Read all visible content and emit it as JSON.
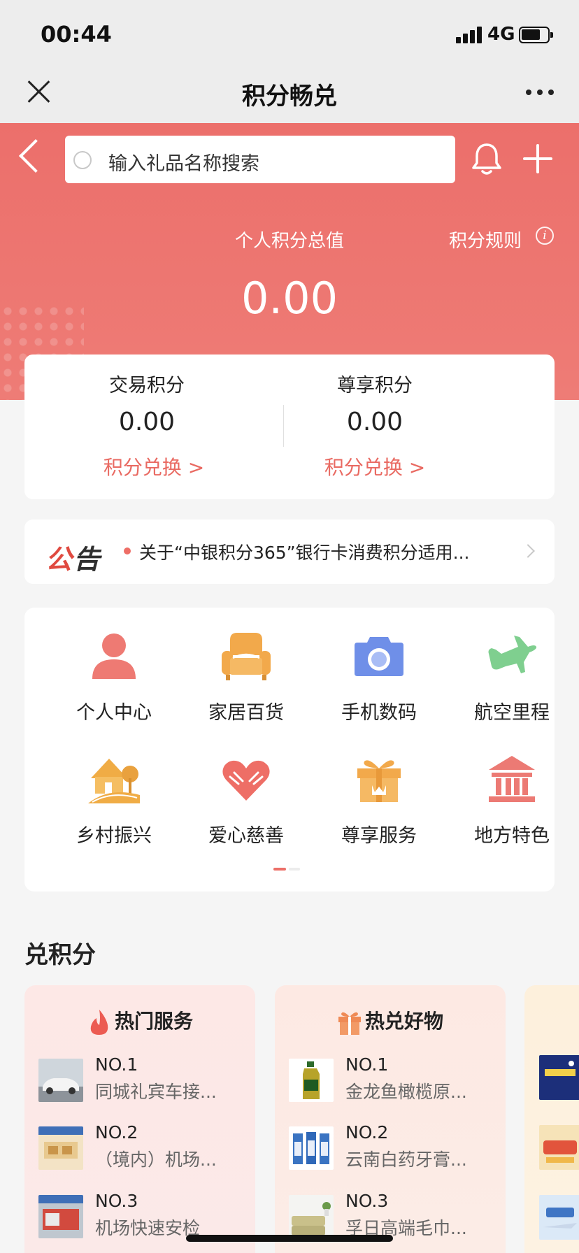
{
  "status_bar": {
    "time": "00:44",
    "network": "4G"
  },
  "nav": {
    "title": "积分畅兑"
  },
  "header": {
    "search_placeholder": "输入礼品名称搜索",
    "total_label": "个人积分总值",
    "rules_label": "积分规则",
    "total_value": "0.00"
  },
  "points": {
    "trade": {
      "label": "交易积分",
      "value": "0.00",
      "link": "积分兑换 >"
    },
    "exclusive": {
      "label": "尊享积分",
      "value": "0.00",
      "link": "积分兑换 >"
    }
  },
  "notice": {
    "logo_part1": "公",
    "logo_part2": "告",
    "text": "关于“中银积分365”银行卡消费积分适用..."
  },
  "categories": [
    {
      "label": "个人中心",
      "icon": "person-icon",
      "color": "#ee7a73"
    },
    {
      "label": "家居百货",
      "icon": "sofa-icon",
      "color": "#f2a94b"
    },
    {
      "label": "手机数码",
      "icon": "camera-icon",
      "color": "#6f8fe8"
    },
    {
      "label": "航空里程",
      "icon": "airplane-icon",
      "color": "#7fcf8f"
    },
    {
      "label": "乡村振兴",
      "icon": "house-icon",
      "color": "#f0ac45"
    },
    {
      "label": "爱心慈善",
      "icon": "heart-hands-icon",
      "color": "#ee6e66"
    },
    {
      "label": "尊享服务",
      "icon": "gift-box-icon",
      "color": "#f2a94b"
    },
    {
      "label": "地方特色",
      "icon": "bank-building-icon",
      "color": "#ec7a74"
    }
  ],
  "pager": {
    "pages": 2,
    "current": 1
  },
  "section": {
    "title": "兑积分"
  },
  "hot_services": {
    "title": "热门服务",
    "items": [
      {
        "no": "NO.1",
        "name": "同城礼宾车接..."
      },
      {
        "no": "NO.2",
        "name": "（境内）机场..."
      },
      {
        "no": "NO.3",
        "name": "机场快速安检"
      }
    ]
  },
  "hot_goods": {
    "title": "热兑好物",
    "items": [
      {
        "no": "NO.1",
        "name": "金龙鱼橄榄原..."
      },
      {
        "no": "NO.2",
        "name": "云南白药牙膏..."
      },
      {
        "no": "NO.3",
        "name": "孚日高端毛巾..."
      }
    ]
  },
  "colors": {
    "brand_red": "#ec6f6b",
    "link_red": "#e96a62"
  }
}
